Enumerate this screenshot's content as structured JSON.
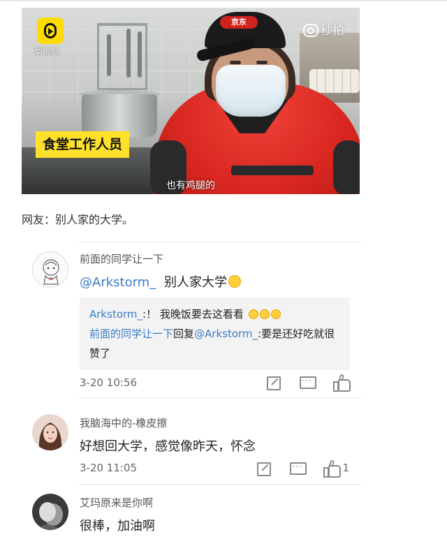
{
  "video": {
    "platform_logo_text": "梨视频",
    "watermark": "秒拍",
    "cap_brand": "京东",
    "caption_tag": "食堂工作人员",
    "subtitle": "也有鸡腿的"
  },
  "post": {
    "text": "网友：别人家的大学。"
  },
  "comments": [
    {
      "username": "前面的同学让一下",
      "mention": "@Arkstorm_",
      "text": "别人家大学",
      "emoji": "cat-face",
      "replies": [
        {
          "name": "Arkstorm_",
          "text": ":！ 我晚饭要去这看看",
          "emojis": [
            "face-emoji",
            "face-emoji",
            "face-emoji"
          ]
        },
        {
          "name": "前面的同学让一下",
          "verb": "回复",
          "target": "@Arkstorm_",
          "text": ":要是还好吃就很赞了"
        }
      ],
      "time": "3-20 10:56",
      "likes": ""
    },
    {
      "username": "我脑海中的-橡皮擦",
      "text": "好想回大学，感觉像昨天，怀念",
      "time": "3-20 11:05",
      "likes": "1"
    },
    {
      "username": "艾玛原来是你啊",
      "text": "很棒，加油啊"
    }
  ],
  "colors": {
    "link": "#3a7cc7",
    "tag_yellow": "#ffe02a",
    "shirt_red": "#d7261f"
  },
  "icons": [
    "share-icon",
    "reply-icon",
    "like-icon",
    "camera-icon",
    "play-icon"
  ]
}
